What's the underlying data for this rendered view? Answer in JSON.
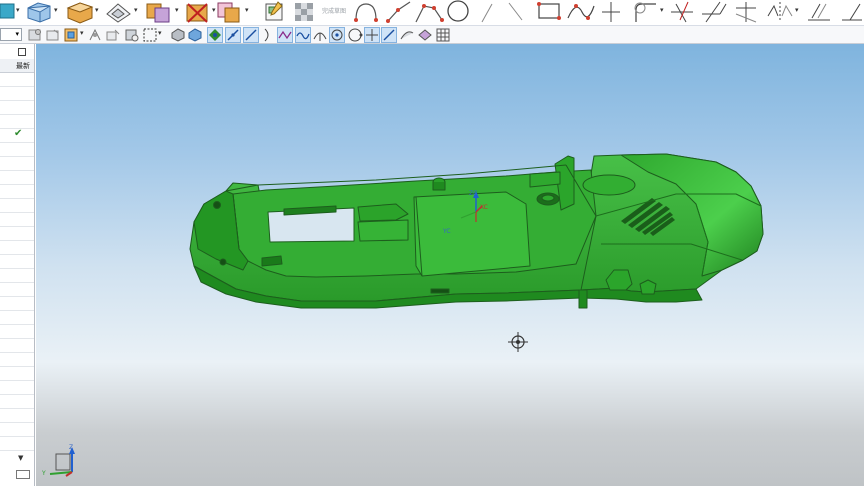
{
  "ribbon": {
    "disabled_label": "完成草图",
    "tools": [
      "sketch-icon",
      "block-icon",
      "extrude-icon",
      "revolve-icon",
      "unite-icon",
      "subtract-icon",
      "intersect-icon",
      "sketch-finish-icon",
      "checker-icon",
      "arc-icon",
      "polyline-icon",
      "profile-icon",
      "circle-icon",
      "rectangle-icon",
      "studio-spline-icon",
      "point-icon",
      "fillet-icon",
      "trim-icon",
      "extend-icon",
      "offset-curve-icon",
      "mirror-icon",
      "pattern-icon"
    ]
  },
  "selection_bar": {
    "filter_value": "",
    "tools": [
      "snap-icon",
      "select-part-icon",
      "select-box-icon",
      "select-feature-icon",
      "shaded-box-icon",
      "select-all-icon",
      "end-point-icon",
      "mid-point-icon",
      "control-point-icon",
      "intersection-icon",
      "arc-center-icon",
      "quadrant-icon",
      "existing-point-icon",
      "point-on-curve-icon",
      "point-on-face-icon",
      "grid-icon"
    ]
  },
  "navigator": {
    "header": "最新",
    "check": "✔",
    "bottom_dd": "▼"
  },
  "viewport": {
    "wcs_labels": {
      "zc": "ZC",
      "yc": "YC",
      "xc": "XC"
    },
    "triad_labels": {
      "z": "Z",
      "y": "Y"
    },
    "colors": {
      "part": "#2eaa2e",
      "part_edge": "#1d5e1d",
      "axis_z": "#2060d0",
      "axis_x": "#c03030",
      "axis_y": "#30a030"
    }
  }
}
